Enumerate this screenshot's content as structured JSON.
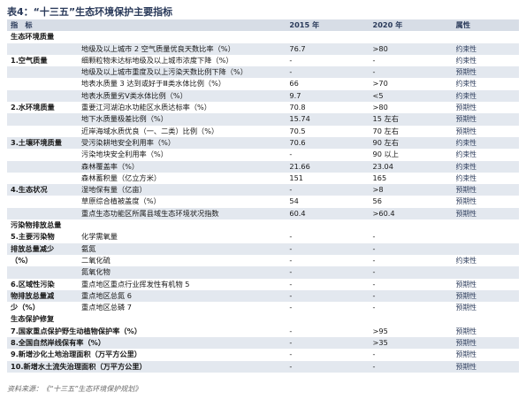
{
  "title": "表4：“十三五”生态环境保护主要指标",
  "header": {
    "col1": "指　标",
    "col2": "2015 年",
    "col3": "2020 年",
    "col4": "属性"
  },
  "sections": {
    "s1": "生态环境质量",
    "s2": "污染物排放总量",
    "s3": "生态保护修复"
  },
  "rows": [
    {
      "cat": "",
      "ind": "地级及以上城市 2 空气质量优良天数比率（%）",
      "y15": "76.7",
      "y20": ">80",
      "attr": "约束性"
    },
    {
      "cat": "1.空气质量",
      "ind": "细颗粒物未达标地级及以上城市浓度下降（%）",
      "y15": "-",
      "y20": "-",
      "attr": "约束性"
    },
    {
      "cat": "",
      "ind": "地级及以上城市重度及以上污染天数比例下降（%）",
      "y15": "-",
      "y20": "-",
      "attr": "预期性"
    },
    {
      "cat": "",
      "ind": "地表水质量 3 达到或好于Ⅲ类水体比例（%）",
      "y15": "66",
      "y20": ">70",
      "attr": "约束性"
    },
    {
      "cat": "",
      "ind": "地表水质量劣Ⅴ类水体比例（%）",
      "y15": "9.7",
      "y20": "<5",
      "attr": "约束性"
    },
    {
      "cat": "2.水环境质量",
      "ind": "重要江河湖泊水功能区水质达标率（%）",
      "y15": "70.8",
      "y20": ">80",
      "attr": "预期性"
    },
    {
      "cat": "",
      "ind": "地下水质量极差比例（%）",
      "y15": "15.74",
      "y20": "15 左右",
      "attr": "预期性"
    },
    {
      "cat": "",
      "ind": "近岸海域水质优良（一、二类）比例（%）",
      "y15": "70.5",
      "y20": "70 左右",
      "attr": "预期性"
    },
    {
      "cat": "3.土壤环境质量",
      "ind": "受污染耕地安全利用率（%）",
      "y15": "70.6",
      "y20": "90 左右",
      "attr": "约束性"
    },
    {
      "cat": "",
      "ind": "污染地块安全利用率（%）",
      "y15": "-",
      "y20": "90 以上",
      "attr": "约束性"
    },
    {
      "cat": "",
      "ind": "森林覆盖率（%）",
      "y15": "21.66",
      "y20": "23.04",
      "attr": "约束性"
    },
    {
      "cat": "",
      "ind": "森林蓄积量（亿立方米）",
      "y15": "151",
      "y20": "165",
      "attr": "约束性"
    },
    {
      "cat": "4.生态状况",
      "ind": "湿地保有量（亿亩）",
      "y15": "-",
      "y20": ">8",
      "attr": "预期性"
    },
    {
      "cat": "",
      "ind": "草原综合植被盖度（%）",
      "y15": "54",
      "y20": "56",
      "attr": "预期性"
    },
    {
      "cat": "",
      "ind": "重点生态功能区所属县域生态环境状况指数",
      "y15": "60.4",
      "y20": ">60.4",
      "attr": "预期性"
    }
  ],
  "pollution_rows": [
    {
      "ind": "化学需氧量",
      "y15": "-",
      "y20": "-"
    },
    {
      "ind": "氨氮",
      "y15": "-",
      "y20": "-"
    },
    {
      "ind": "二氧化硫",
      "y15": "-",
      "y20": "-"
    },
    {
      "ind": "氮氧化物",
      "y15": "-",
      "y20": "-"
    },
    {
      "ind": "重点地区重点行业挥发性有机物 5",
      "y15": "-",
      "y20": "-"
    },
    {
      "ind": "重点地区总氮 6",
      "y15": "-",
      "y20": "-"
    },
    {
      "ind": "重点地区总磷 7",
      "y15": "-",
      "y20": "-"
    }
  ],
  "pollution": {
    "cat5_l1": "5.主要污染物",
    "cat5_l2": "排放总量减少",
    "cat5_l3": "（%）",
    "cat6_l1": "6.区域性污染",
    "cat6_l2": "物排放总量减",
    "cat6_l3": "少（%）",
    "attr5": "约束性",
    "attr6a": "预期性",
    "attr6b": "预期性",
    "attr6c": "预期性"
  },
  "eco_rows": [
    {
      "ind": "7.国家重点保护野生动植物保护率（%）",
      "y15": "-",
      "y20": ">95",
      "attr": "预期性"
    },
    {
      "ind": "8.全国自然岸线保有率（%）",
      "y15": "-",
      "y20": ">35",
      "attr": "预期性"
    },
    {
      "ind": "9.新增沙化土地治理面积（万平方公里）",
      "y15": "-",
      "y20": "-",
      "attr": "预期性"
    },
    {
      "ind": "10.新增水土流失治理面积（万平方公里）",
      "y15": "-",
      "y20": "-",
      "attr": "预期性"
    }
  ],
  "source": "资料来源：《“十三五”生态环境保护规划》"
}
